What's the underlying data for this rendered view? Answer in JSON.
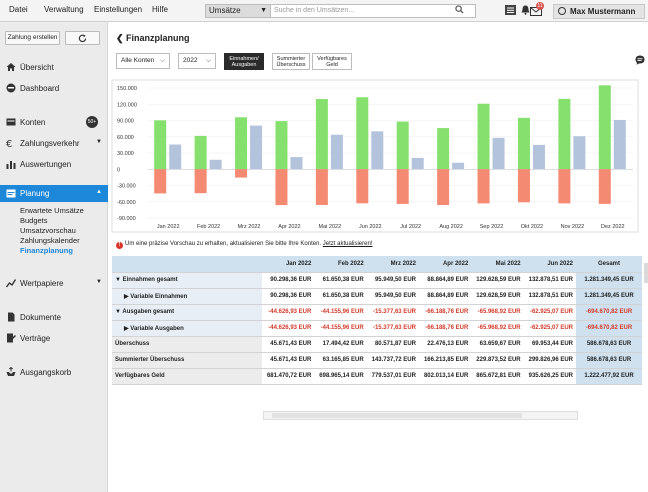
{
  "menu": [
    "Datei",
    "Verwaltung",
    "Einstellungen",
    "Hilfe"
  ],
  "search": {
    "category": "Umsätze",
    "placeholder": "Suche in den Umsätzen..."
  },
  "notifications_count": "11",
  "user_name": "Max Mustermann",
  "sidebar": {
    "create_payment": "Zahlung erstellen",
    "items": [
      "Übersicht",
      "Dashboard",
      "Konten",
      "Zahlungsverkehr",
      "Auswertungen",
      "Planung",
      "Wertpapiere",
      "Dokumente",
      "Verträge",
      "Ausgangskorb"
    ],
    "konten_badge": "50+",
    "planning_sub": [
      "Erwartete Umsätze",
      "Budgets",
      "Umsatzvorschau",
      "Zahlungskalender",
      "Finanzplanung"
    ]
  },
  "page": {
    "title": "Finanzplanung",
    "account_select": "Alle Konten",
    "year_select": "2022",
    "toggles": [
      {
        "line1": "Einnahmen/",
        "line2": "Ausgaben"
      },
      {
        "line1": "Summierter",
        "line2": "Überschuss"
      },
      {
        "line1": "Verfügbares",
        "line2": "Geld"
      }
    ],
    "notice": "Um eine präzise Vorschau zu erhalten, aktualisieren Sie bitte Ihre Konten.",
    "notice_link": "Jetzt aktualisieren!"
  },
  "colors": {
    "income": "#86e06e",
    "expense": "#f58a73",
    "surplus": "#b3c3dc",
    "accent": "#1d87d9"
  },
  "chart_data": {
    "type": "bar",
    "categories": [
      "Jan 2022",
      "Feb 2022",
      "Mrz 2022",
      "Apr 2022",
      "Mai 2022",
      "Jun 2022",
      "Jul 2022",
      "Aug 2022",
      "Sep 2022",
      "Okt 2022",
      "Nov 2022",
      "Dez 2022"
    ],
    "series": [
      {
        "name": "Einnahmen",
        "values": [
          90298,
          61650,
          95949,
          88864,
          129628,
          132878,
          88000,
          76000,
          121000,
          95000,
          130000,
          155000
        ]
      },
      {
        "name": "Ausgaben",
        "values": [
          -44626,
          -44155,
          -15377,
          -66188,
          -65968,
          -62925,
          -64000,
          -66000,
          -63000,
          -61000,
          -63000,
          -64000
        ]
      },
      {
        "name": "Überschuss",
        "values": [
          45671,
          17494,
          80571,
          22476,
          63659,
          69953,
          21000,
          12000,
          58000,
          45000,
          61000,
          91000
        ]
      }
    ],
    "yticks": [
      "150.000",
      "120.000",
      "90.000",
      "60.000",
      "30.000",
      "0",
      "-30.000",
      "-60.000",
      "-90.000"
    ],
    "ylim": [
      -90000,
      160000
    ]
  },
  "table": {
    "columns": [
      "Jan 2022",
      "Feb 2022",
      "Mrz 2022",
      "Apr 2022",
      "Mai 2022",
      "Jun 2022",
      "Gesamt"
    ],
    "rows": [
      {
        "label": "▼ Einnahmen gesamt",
        "values": [
          "90.298,36 EUR",
          "61.650,38 EUR",
          "95.949,50 EUR",
          "88.864,89 EUR",
          "129.628,59 EUR",
          "132.878,51 EUR",
          "1.281.349,45 EUR"
        ]
      },
      {
        "label": "▶ Variable Einnahmen",
        "values": [
          "90.298,36 EUR",
          "61.650,38 EUR",
          "95.949,50 EUR",
          "88.864,89 EUR",
          "129.628,59 EUR",
          "132.878,51 EUR",
          "1.281.349,45 EUR"
        ]
      },
      {
        "label": "▼ Ausgaben gesamt",
        "values": [
          "-44.626,93 EUR",
          "-44.155,96 EUR",
          "-15.377,63 EUR",
          "-66.188,76 EUR",
          "-65.968,92 EUR",
          "-62.925,07 EUR",
          "-694.670,82 EUR"
        ]
      },
      {
        "label": "▶ Variable Ausgaben",
        "values": [
          "-44.626,93 EUR",
          "-44.155,96 EUR",
          "-15.377,63 EUR",
          "-66.188,76 EUR",
          "-65.968,92 EUR",
          "-62.925,07 EUR",
          "-694.670,82 EUR"
        ]
      },
      {
        "label": "Überschuss",
        "values": [
          "45.671,43 EUR",
          "17.494,42 EUR",
          "80.571,87 EUR",
          "22.476,13 EUR",
          "63.659,67 EUR",
          "69.953,44 EUR",
          "586.678,63 EUR"
        ]
      },
      {
        "label": "Summierter Überschuss",
        "values": [
          "45.671,43 EUR",
          "63.165,85 EUR",
          "143.737,72 EUR",
          "166.213,85 EUR",
          "229.873,52 EUR",
          "299.826,96 EUR",
          "586.678,63 EUR"
        ]
      },
      {
        "label": "Verfügbares Geld",
        "values": [
          "681.470,72 EUR",
          "698.965,14 EUR",
          "779.537,01 EUR",
          "802.013,14 EUR",
          "865.672,81 EUR",
          "935.626,25 EUR",
          "1.222.477,92 EUR"
        ]
      }
    ]
  }
}
